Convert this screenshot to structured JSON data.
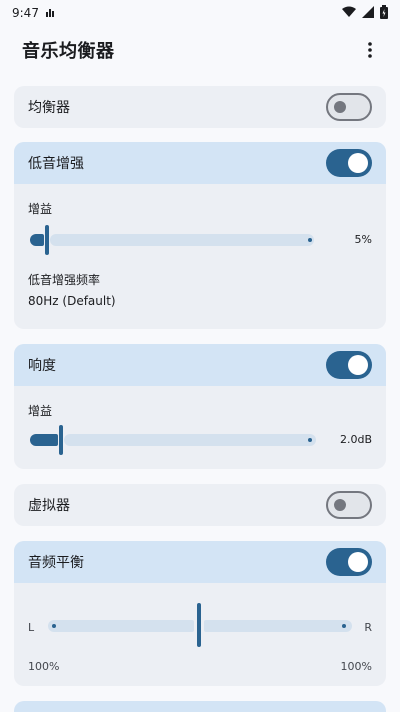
{
  "status_bar": {
    "time": "9:47",
    "icons": [
      "signal-bars-icon",
      "wifi-icon",
      "cellular-icon",
      "battery-icon"
    ]
  },
  "app_bar": {
    "title": "音乐均衡器",
    "menu_icon": "more-vert-icon"
  },
  "colors": {
    "accent": "#2a6390",
    "card_bg": "#eceff4",
    "card_active_header": "#d3e4f5",
    "track": "#d4e1ee"
  },
  "cards": {
    "equalizer": {
      "title": "均衡器",
      "enabled": false
    },
    "bass_boost": {
      "title": "低音增强",
      "enabled": true,
      "gain_label": "增益",
      "gain_value": "5%",
      "gain_fraction": 0.05,
      "freq_label": "低音增强频率",
      "freq_value": "80Hz (Default)"
    },
    "loudness": {
      "title": "响度",
      "enabled": true,
      "gain_label": "增益",
      "gain_value": "2.0dB",
      "gain_fraction": 0.1
    },
    "virtualizer": {
      "title": "虚拟器",
      "enabled": false
    },
    "balance": {
      "title": "音频平衡",
      "enabled": true,
      "left_label": "L",
      "right_label": "R",
      "left_value": "100%",
      "right_value": "100%",
      "position": 0.5
    }
  }
}
